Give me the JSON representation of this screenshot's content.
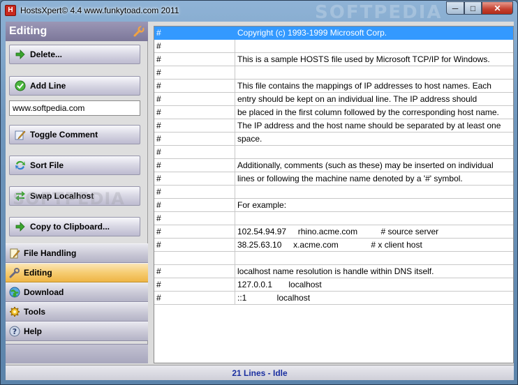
{
  "window": {
    "title": "HostsXpert© 4.4  www.funkytoad.com 2011",
    "watermark": "SOFTPEDIA",
    "controls": {
      "minimize": "─",
      "maximize": "□",
      "close": "✕"
    }
  },
  "left_panel": {
    "header": "Editing",
    "header_icon": "wrench-icon",
    "actions": [
      {
        "label": "Delete...",
        "icon": "green-arrow-icon"
      },
      {
        "label": "Add Line",
        "icon": "green-check-icon"
      },
      {
        "label": "Toggle Comment",
        "icon": "pencil-icon"
      },
      {
        "label": "Sort File",
        "icon": "sort-arrows-icon"
      },
      {
        "label": "Swap Localhost",
        "icon": "swap-arrows-icon"
      },
      {
        "label": "Copy to Clipboard...",
        "icon": "green-arrow-icon"
      }
    ],
    "input_value": "www.softpedia.com",
    "watermark": "SOFTPEDIA",
    "nav": [
      {
        "label": "File Handling",
        "icon": "file-pencil-icon",
        "active": false
      },
      {
        "label": "Editing",
        "icon": "wrench-icon",
        "active": true
      },
      {
        "label": "Download",
        "icon": "download-globe-icon",
        "active": false
      },
      {
        "label": "Tools",
        "icon": "tools-icon",
        "active": false
      },
      {
        "label": "Help",
        "icon": "help-icon",
        "active": false
      }
    ]
  },
  "grid": {
    "rows": [
      {
        "ip": "#",
        "text": "Copyright (c) 1993-1999 Microsoft Corp.",
        "selected": true
      },
      {
        "ip": "#",
        "text": ""
      },
      {
        "ip": "#",
        "text": "This is a sample HOSTS file used by Microsoft TCP/IP for Windows."
      },
      {
        "ip": "#",
        "text": ""
      },
      {
        "ip": "#",
        "text": "This file contains the mappings of IP addresses to host names. Each"
      },
      {
        "ip": "#",
        "text": "entry should be kept on an individual line. The IP address should"
      },
      {
        "ip": "#",
        "text": "be placed in the first column followed by the corresponding host name."
      },
      {
        "ip": "#",
        "text": "The IP address and the host name should be separated by at least one"
      },
      {
        "ip": "#",
        "text": "space."
      },
      {
        "ip": "#",
        "text": ""
      },
      {
        "ip": "#",
        "text": "Additionally, comments (such as these) may be inserted on individual"
      },
      {
        "ip": "#",
        "text": "lines or following the machine name denoted by a '#' symbol."
      },
      {
        "ip": "#",
        "text": ""
      },
      {
        "ip": "#",
        "text": "For example:"
      },
      {
        "ip": "#",
        "text": ""
      },
      {
        "ip": "#",
        "text": "102.54.94.97     rhino.acme.com          # source server"
      },
      {
        "ip": "#",
        "text": "38.25.63.10     x.acme.com              # x client host"
      },
      {
        "ip": "",
        "text": ""
      },
      {
        "ip": "#",
        "text": "localhost name resolution is handle within DNS itself."
      },
      {
        "ip": "#",
        "text": "127.0.0.1       localhost"
      },
      {
        "ip": "#",
        "text": "::1             localhost"
      }
    ]
  },
  "status": "21 Lines - Idle"
}
